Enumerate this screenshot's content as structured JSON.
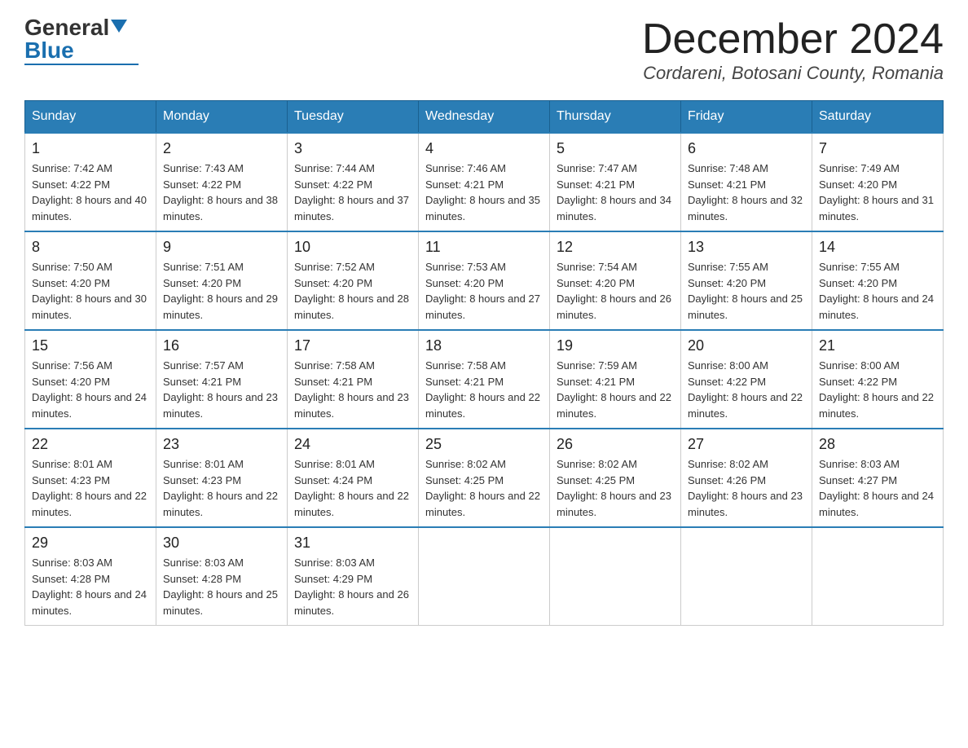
{
  "logo": {
    "general": "General",
    "blue": "Blue"
  },
  "title": {
    "month": "December 2024",
    "location": "Cordareni, Botosani County, Romania"
  },
  "headers": [
    "Sunday",
    "Monday",
    "Tuesday",
    "Wednesday",
    "Thursday",
    "Friday",
    "Saturday"
  ],
  "weeks": [
    [
      {
        "day": "1",
        "sunrise": "7:42 AM",
        "sunset": "4:22 PM",
        "daylight": "8 hours and 40 minutes."
      },
      {
        "day": "2",
        "sunrise": "7:43 AM",
        "sunset": "4:22 PM",
        "daylight": "8 hours and 38 minutes."
      },
      {
        "day": "3",
        "sunrise": "7:44 AM",
        "sunset": "4:22 PM",
        "daylight": "8 hours and 37 minutes."
      },
      {
        "day": "4",
        "sunrise": "7:46 AM",
        "sunset": "4:21 PM",
        "daylight": "8 hours and 35 minutes."
      },
      {
        "day": "5",
        "sunrise": "7:47 AM",
        "sunset": "4:21 PM",
        "daylight": "8 hours and 34 minutes."
      },
      {
        "day": "6",
        "sunrise": "7:48 AM",
        "sunset": "4:21 PM",
        "daylight": "8 hours and 32 minutes."
      },
      {
        "day": "7",
        "sunrise": "7:49 AM",
        "sunset": "4:20 PM",
        "daylight": "8 hours and 31 minutes."
      }
    ],
    [
      {
        "day": "8",
        "sunrise": "7:50 AM",
        "sunset": "4:20 PM",
        "daylight": "8 hours and 30 minutes."
      },
      {
        "day": "9",
        "sunrise": "7:51 AM",
        "sunset": "4:20 PM",
        "daylight": "8 hours and 29 minutes."
      },
      {
        "day": "10",
        "sunrise": "7:52 AM",
        "sunset": "4:20 PM",
        "daylight": "8 hours and 28 minutes."
      },
      {
        "day": "11",
        "sunrise": "7:53 AM",
        "sunset": "4:20 PM",
        "daylight": "8 hours and 27 minutes."
      },
      {
        "day": "12",
        "sunrise": "7:54 AM",
        "sunset": "4:20 PM",
        "daylight": "8 hours and 26 minutes."
      },
      {
        "day": "13",
        "sunrise": "7:55 AM",
        "sunset": "4:20 PM",
        "daylight": "8 hours and 25 minutes."
      },
      {
        "day": "14",
        "sunrise": "7:55 AM",
        "sunset": "4:20 PM",
        "daylight": "8 hours and 24 minutes."
      }
    ],
    [
      {
        "day": "15",
        "sunrise": "7:56 AM",
        "sunset": "4:20 PM",
        "daylight": "8 hours and 24 minutes."
      },
      {
        "day": "16",
        "sunrise": "7:57 AM",
        "sunset": "4:21 PM",
        "daylight": "8 hours and 23 minutes."
      },
      {
        "day": "17",
        "sunrise": "7:58 AM",
        "sunset": "4:21 PM",
        "daylight": "8 hours and 23 minutes."
      },
      {
        "day": "18",
        "sunrise": "7:58 AM",
        "sunset": "4:21 PM",
        "daylight": "8 hours and 22 minutes."
      },
      {
        "day": "19",
        "sunrise": "7:59 AM",
        "sunset": "4:21 PM",
        "daylight": "8 hours and 22 minutes."
      },
      {
        "day": "20",
        "sunrise": "8:00 AM",
        "sunset": "4:22 PM",
        "daylight": "8 hours and 22 minutes."
      },
      {
        "day": "21",
        "sunrise": "8:00 AM",
        "sunset": "4:22 PM",
        "daylight": "8 hours and 22 minutes."
      }
    ],
    [
      {
        "day": "22",
        "sunrise": "8:01 AM",
        "sunset": "4:23 PM",
        "daylight": "8 hours and 22 minutes."
      },
      {
        "day": "23",
        "sunrise": "8:01 AM",
        "sunset": "4:23 PM",
        "daylight": "8 hours and 22 minutes."
      },
      {
        "day": "24",
        "sunrise": "8:01 AM",
        "sunset": "4:24 PM",
        "daylight": "8 hours and 22 minutes."
      },
      {
        "day": "25",
        "sunrise": "8:02 AM",
        "sunset": "4:25 PM",
        "daylight": "8 hours and 22 minutes."
      },
      {
        "day": "26",
        "sunrise": "8:02 AM",
        "sunset": "4:25 PM",
        "daylight": "8 hours and 23 minutes."
      },
      {
        "day": "27",
        "sunrise": "8:02 AM",
        "sunset": "4:26 PM",
        "daylight": "8 hours and 23 minutes."
      },
      {
        "day": "28",
        "sunrise": "8:03 AM",
        "sunset": "4:27 PM",
        "daylight": "8 hours and 24 minutes."
      }
    ],
    [
      {
        "day": "29",
        "sunrise": "8:03 AM",
        "sunset": "4:28 PM",
        "daylight": "8 hours and 24 minutes."
      },
      {
        "day": "30",
        "sunrise": "8:03 AM",
        "sunset": "4:28 PM",
        "daylight": "8 hours and 25 minutes."
      },
      {
        "day": "31",
        "sunrise": "8:03 AM",
        "sunset": "4:29 PM",
        "daylight": "8 hours and 26 minutes."
      },
      null,
      null,
      null,
      null
    ]
  ]
}
